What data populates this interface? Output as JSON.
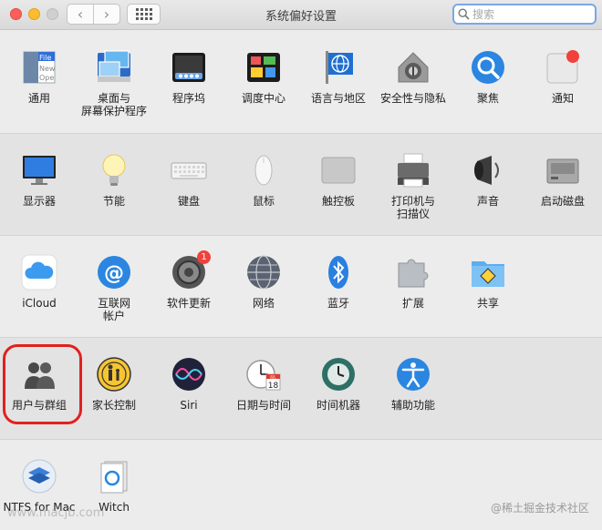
{
  "window": {
    "title": "系统偏好设置"
  },
  "toolbar": {
    "back_glyph": "‹",
    "forward_glyph": "›"
  },
  "search": {
    "placeholder": "搜索",
    "icon": "magnifier-icon"
  },
  "sections": [
    {
      "items": [
        {
          "label": "通用",
          "icon": "general-icon"
        },
        {
          "label": "桌面与\n屏幕保护程序",
          "icon": "desktop-screensaver-icon"
        },
        {
          "label": "程序坞",
          "icon": "dock-icon"
        },
        {
          "label": "调度中心",
          "icon": "mission-control-icon"
        },
        {
          "label": "语言与地区",
          "icon": "language-region-icon"
        },
        {
          "label": "安全性与隐私",
          "icon": "security-privacy-icon"
        },
        {
          "label": "聚焦",
          "icon": "spotlight-icon"
        },
        {
          "label": "通知",
          "icon": "notifications-icon"
        }
      ]
    },
    {
      "items": [
        {
          "label": "显示器",
          "icon": "displays-icon"
        },
        {
          "label": "节能",
          "icon": "energy-saver-icon"
        },
        {
          "label": "键盘",
          "icon": "keyboard-icon"
        },
        {
          "label": "鼠标",
          "icon": "mouse-icon"
        },
        {
          "label": "触控板",
          "icon": "trackpad-icon"
        },
        {
          "label": "打印机与\n扫描仪",
          "icon": "printer-scanner-icon"
        },
        {
          "label": "声音",
          "icon": "sound-icon"
        },
        {
          "label": "启动磁盘",
          "icon": "startup-disk-icon"
        }
      ]
    },
    {
      "items": [
        {
          "label": "iCloud",
          "icon": "icloud-icon"
        },
        {
          "label": "互联网\n帐户",
          "icon": "internet-accounts-icon"
        },
        {
          "label": "软件更新",
          "icon": "software-update-icon",
          "badge": "1"
        },
        {
          "label": "网络",
          "icon": "network-icon"
        },
        {
          "label": "蓝牙",
          "icon": "bluetooth-icon"
        },
        {
          "label": "扩展",
          "icon": "extensions-icon"
        },
        {
          "label": "共享",
          "icon": "sharing-icon"
        }
      ]
    },
    {
      "items": [
        {
          "label": "用户与群组",
          "icon": "users-groups-icon"
        },
        {
          "label": "家长控制",
          "icon": "parental-controls-icon"
        },
        {
          "label": "Siri",
          "icon": "siri-icon"
        },
        {
          "label": "日期与时间",
          "icon": "date-time-icon",
          "calendar_month": "JUL",
          "calendar_day": "18"
        },
        {
          "label": "时间机器",
          "icon": "time-machine-icon"
        },
        {
          "label": "辅助功能",
          "icon": "accessibility-icon"
        }
      ]
    },
    {
      "items": [
        {
          "label": "NTFS for Mac",
          "icon": "ntfs-for-mac-icon"
        },
        {
          "label": "Witch",
          "icon": "witch-icon"
        }
      ]
    }
  ],
  "general_icon_text": [
    "File",
    "New",
    "Ope"
  ],
  "watermark": "www.macjb.com",
  "credit": "@稀土掘金技术社区",
  "colors": {
    "highlight": "#e0211f",
    "badge": "#f0413a",
    "search_focus": "#7aa8e8"
  }
}
